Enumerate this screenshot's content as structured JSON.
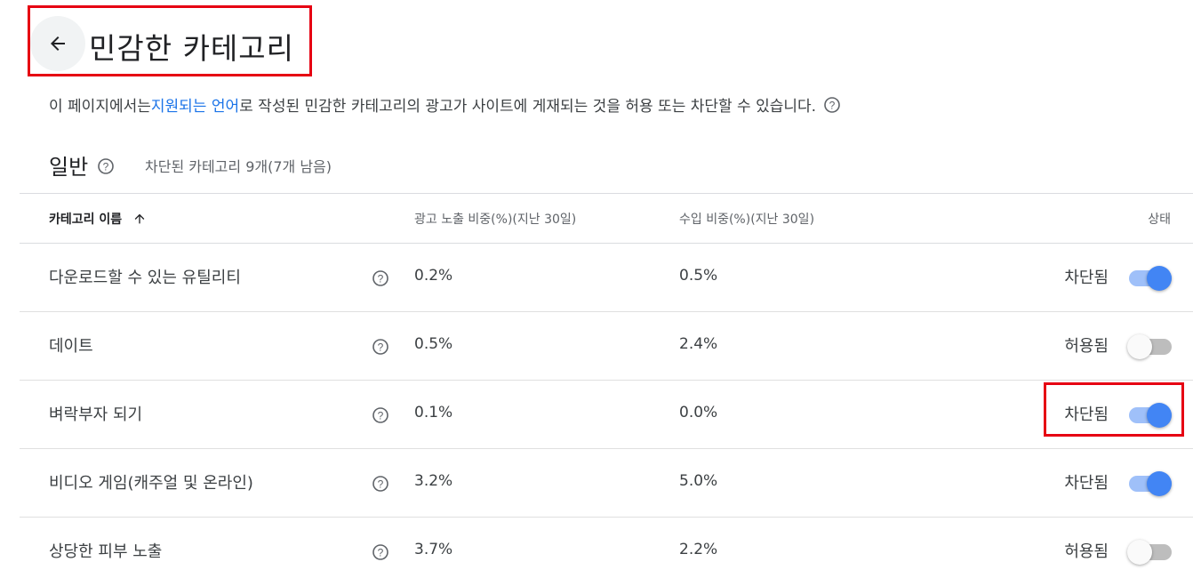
{
  "header": {
    "back_icon": "arrow-left-icon",
    "title": "민감한 카테고리"
  },
  "description": {
    "before": "이 페이지에서는 ",
    "link": "지원되는 언어",
    "after": "로 작성된 민감한 카테고리의 광고가 사이트에 게재되는 것을 허용 또는 차단할 수 있습니다.",
    "help_icon": "help-circle-icon"
  },
  "section": {
    "title": "일반",
    "summary": "차단된 카테고리 9개(7개 남음)"
  },
  "table": {
    "columns": {
      "name": "카테고리 이름",
      "impressions": "광고 노출 비중(%)(지난 30일)",
      "revenue": "수입 비중(%)(지난 30일)",
      "status": "상태"
    },
    "sort_icon": "arrow-up-icon",
    "rows": [
      {
        "name": "다운로드할 수 있는 유틸리티",
        "impressions": "0.2%",
        "revenue": "0.5%",
        "status": "차단됨",
        "enabled": true
      },
      {
        "name": "데이트",
        "impressions": "0.5%",
        "revenue": "2.4%",
        "status": "허용됨",
        "enabled": false
      },
      {
        "name": "벼락부자 되기",
        "impressions": "0.1%",
        "revenue": "0.0%",
        "status": "차단됨",
        "enabled": true
      },
      {
        "name": "비디오 게임(캐주얼 및 온라인)",
        "impressions": "3.2%",
        "revenue": "5.0%",
        "status": "차단됨",
        "enabled": true
      },
      {
        "name": "상당한 피부 노출",
        "impressions": "3.7%",
        "revenue": "2.2%",
        "status": "허용됨",
        "enabled": false
      }
    ]
  },
  "colors": {
    "accent": "#4285f4",
    "link": "#1a73e8",
    "highlight": "#e60012"
  }
}
